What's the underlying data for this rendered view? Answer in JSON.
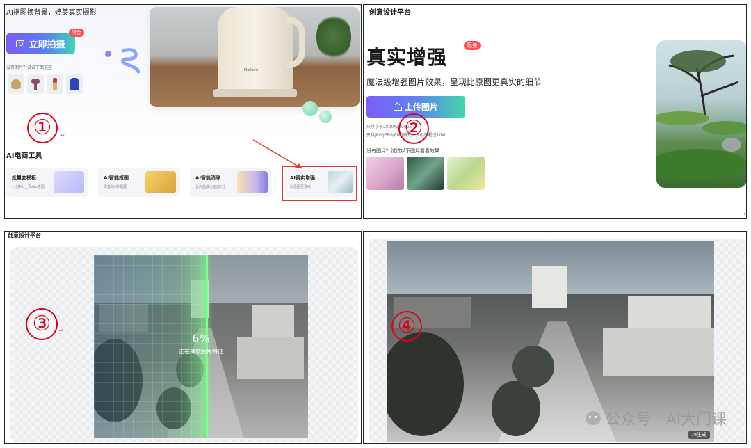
{
  "panel1": {
    "headline": "AI抠图换背景，媲美真实摄影",
    "shoot_button": "立即拍摄",
    "badge": "限免",
    "hint": "没有图片？试试下面这些",
    "number": "①",
    "section_title": "AI电商工具",
    "hero_brand": "Mallonis",
    "tools": [
      {
        "name": "批量套模板",
        "desc": "1分钟出上百sku主图"
      },
      {
        "name": "AI智能抠图",
        "desc": "零基础3秒抠图"
      },
      {
        "name": "AI智能消除",
        "desc": "让商品成为画面C位"
      },
      {
        "name": "AI真实增强",
        "desc": "比原图更清晰"
      }
    ],
    "accent": "#e53935"
  },
  "panel2": {
    "platform": "创意设计平台",
    "title": "真实增强",
    "badge": "限免",
    "subtitle": "魔法级增强图片效果，呈现比原图更真实的细节",
    "upload_button": "上传图片",
    "note1": "尺寸小于2000*2000px",
    "note2": "支持JPG/JPEG/PNG格式，大小不超过10M",
    "try_text": "没有图片？试试以下图片看看效果",
    "number": "②"
  },
  "panel3": {
    "platform": "创意设计平台",
    "progress_percent": "6%",
    "progress_label": "正在提取图片特征",
    "scan_fraction": 0.53,
    "number": "③"
  },
  "panel4": {
    "ai_tag": "AI生成",
    "watermark": "公众号 · AI大门课",
    "number": "④"
  },
  "return_mark": "↵"
}
